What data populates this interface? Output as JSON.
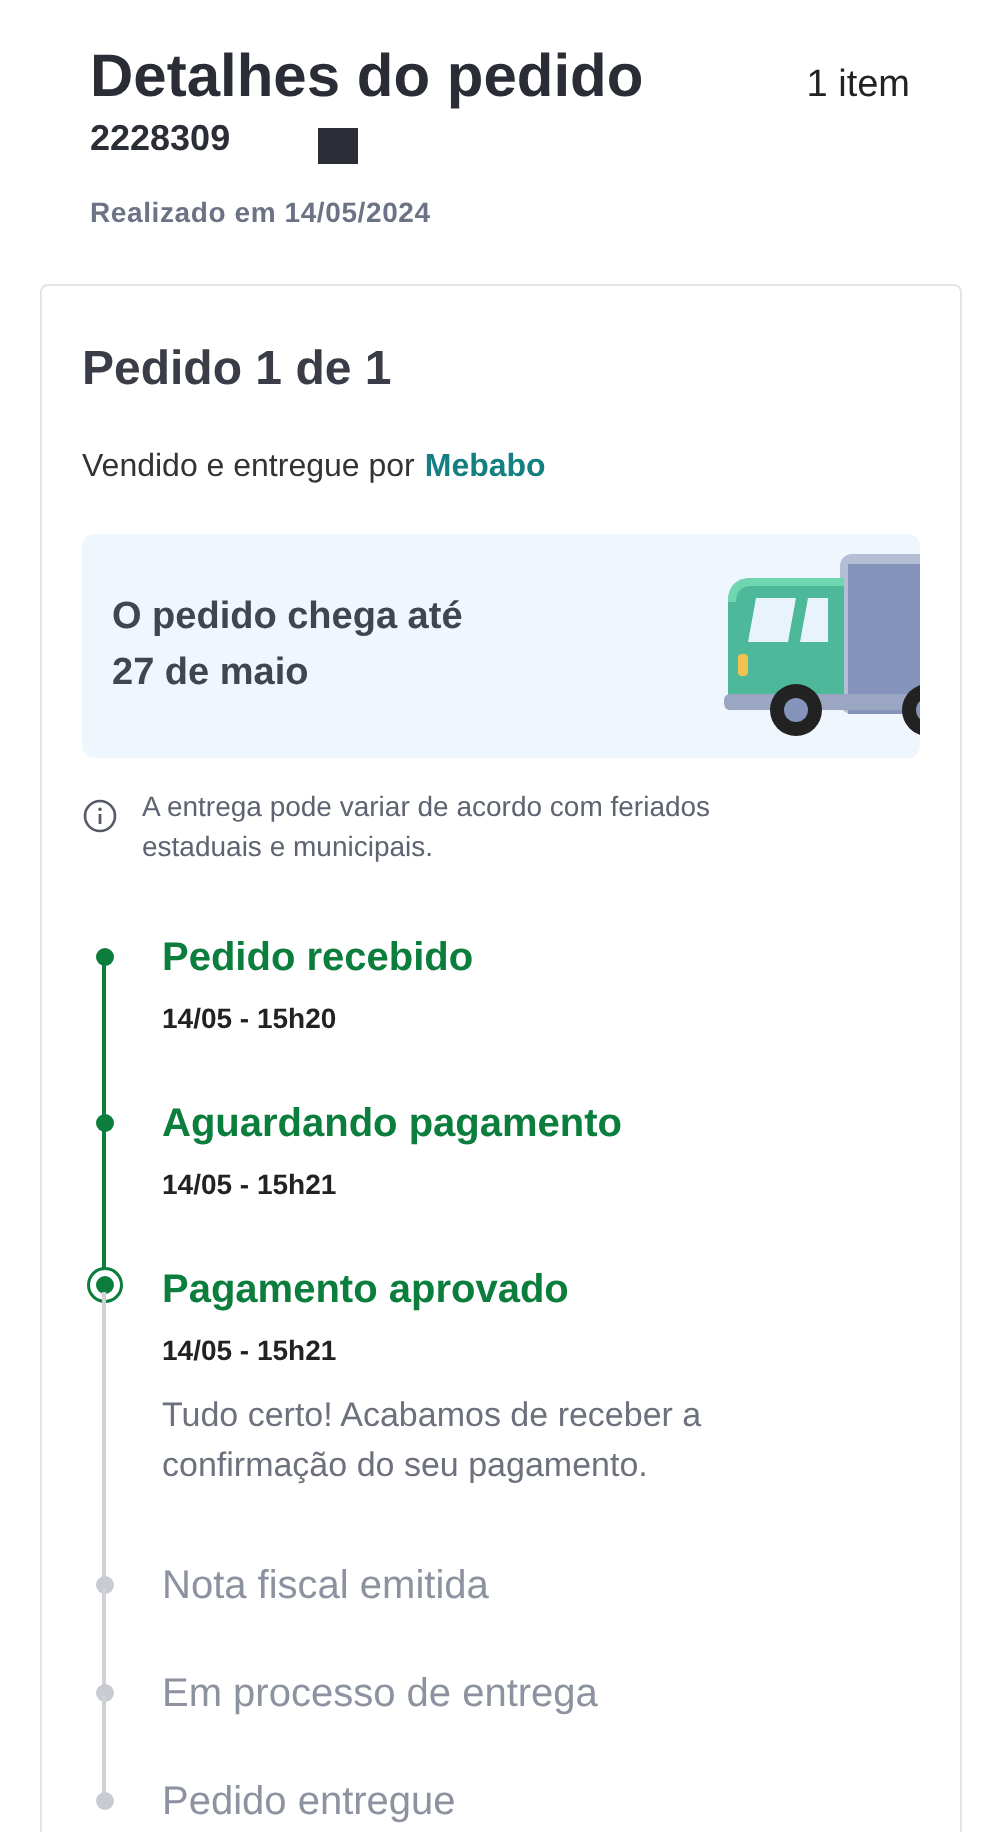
{
  "header": {
    "title": "Detalhes do pedido",
    "item_count": "1 item",
    "order_number": "2228309",
    "placed_on": "Realizado em 14/05/2024"
  },
  "order": {
    "title": "Pedido 1 de 1",
    "seller_prefix": "Vendido e entregue por",
    "seller": "Mebabo",
    "delivery": {
      "line_1": "O pedido chega até",
      "line_2": "27 de maio"
    },
    "notice": "A entrega pode variar de acordo com feriados estaduais e municipais.",
    "steps": [
      {
        "title": "Pedido recebido",
        "kind": "done",
        "time": "14/05 - 15h20"
      },
      {
        "title": "Aguardando pagamento",
        "kind": "done",
        "time": "14/05 - 15h21"
      },
      {
        "title": "Pagamento aprovado",
        "kind": "current",
        "time": "14/05 - 15h21",
        "description": "Tudo certo! Acabamos de receber a confirmação do seu pagamento."
      },
      {
        "title": "Nota fiscal emitida",
        "kind": "pending"
      },
      {
        "title": "Em processo de entrega",
        "kind": "pending"
      },
      {
        "title": "Pedido entregue",
        "kind": "pending"
      }
    ]
  }
}
